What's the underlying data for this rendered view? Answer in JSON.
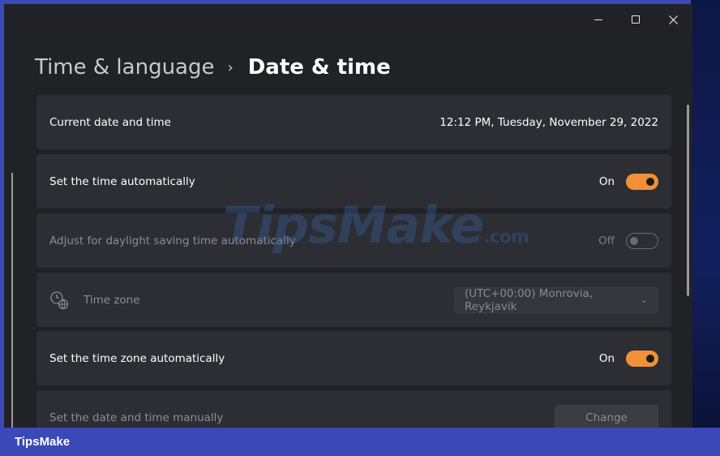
{
  "window": {
    "minimize_icon": "minimize-icon",
    "maximize_icon": "maximize-icon",
    "close_icon": "close-icon"
  },
  "breadcrumb": {
    "parent": "Time & language",
    "separator": "›",
    "current": "Date & time"
  },
  "settings": {
    "current_date": {
      "label": "Current date and time",
      "value": "12:12 PM, Tuesday, November 29, 2022"
    },
    "set_time_auto": {
      "label": "Set the time automatically",
      "state": "On",
      "enabled": true
    },
    "daylight_saving": {
      "label": "Adjust for daylight saving time automatically",
      "state": "Off",
      "enabled": false
    },
    "time_zone": {
      "label": "Time zone",
      "icon": "clock-globe-icon",
      "selected": "(UTC+00:00) Monrovia, Reykjavik"
    },
    "set_tz_auto": {
      "label": "Set the time zone automatically",
      "state": "On",
      "enabled": true
    },
    "manual": {
      "label": "Set the date and time manually",
      "button": "Change"
    }
  },
  "watermark": {
    "brand": "TipsMake",
    "suffix": ".com"
  },
  "footer": {
    "brand": "TipsMake"
  },
  "colors": {
    "accent": "#f0913a",
    "card_bg": "#2c2e33",
    "window_bg": "#202226",
    "frame": "#3b48b8"
  }
}
